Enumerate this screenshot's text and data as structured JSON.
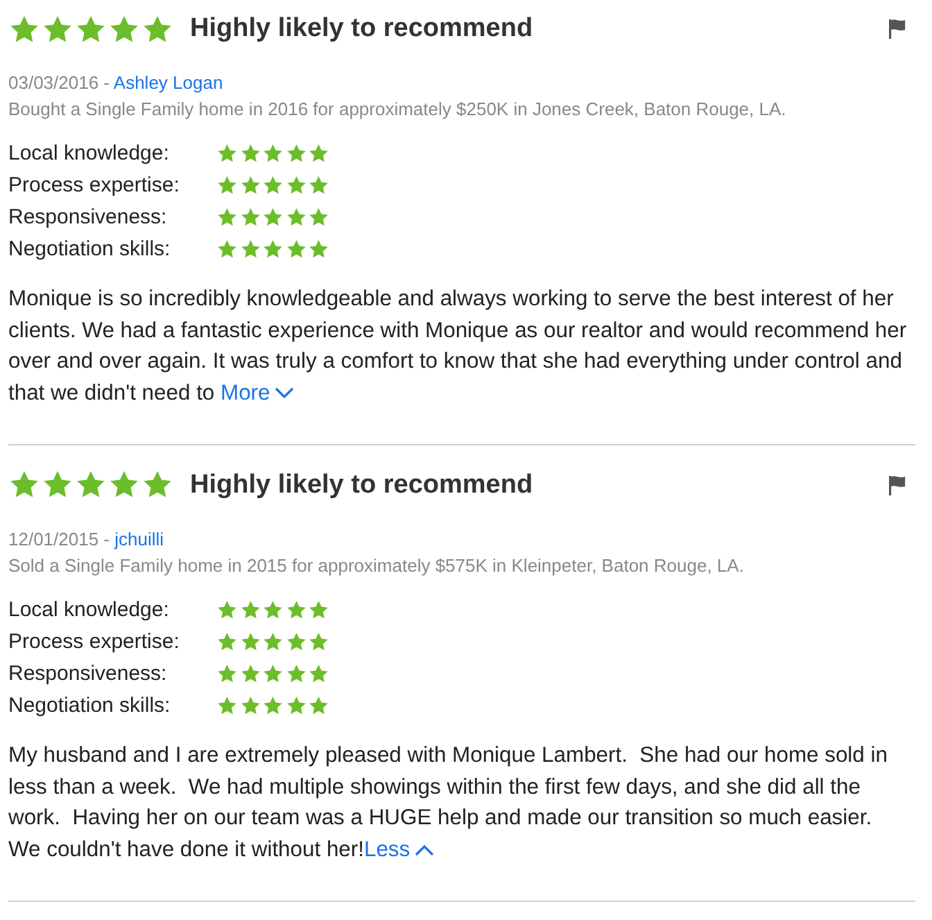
{
  "reviews": [
    {
      "stars": 5,
      "headline": "Highly likely to recommend",
      "date": "03/03/2016 - ",
      "author": "Ashley Logan",
      "summary": "Bought a Single Family home in 2016 for approximately $250K in Jones Creek, Baton Rouge, LA.",
      "ratings": [
        {
          "label": "Local knowledge:",
          "stars": 5
        },
        {
          "label": "Process expertise:",
          "stars": 5
        },
        {
          "label": "Responsiveness:",
          "stars": 5
        },
        {
          "label": "Negotiation skills:",
          "stars": 5
        }
      ],
      "text": "Monique is so incredibly knowledgeable and always working to serve the best interest of her clients. We had a fantastic experience with Monique as our realtor and would recommend her over and over again. It was truly a comfort to know that she had everything under control and that we didn't need to ",
      "toggle": {
        "label": "More",
        "expanded": false
      }
    },
    {
      "stars": 5,
      "headline": "Highly likely to recommend",
      "date": "12/01/2015 - ",
      "author": "jchuilli",
      "summary": "Sold a Single Family home in 2015 for approximately $575K in Kleinpeter, Baton Rouge, LA.",
      "ratings": [
        {
          "label": "Local knowledge:",
          "stars": 5
        },
        {
          "label": "Process expertise:",
          "stars": 5
        },
        {
          "label": "Responsiveness:",
          "stars": 5
        },
        {
          "label": "Negotiation skills:",
          "stars": 5
        }
      ],
      "text": "My husband and I are extremely pleased with Monique Lambert.  She had our home sold in less than a week.  We had multiple showings within the first few days, and she did all the work.  Having her on our team was a HUGE help and made our transition so much easier.  We couldn't have done it without her!",
      "toggle": {
        "label": "Less",
        "expanded": true
      }
    }
  ]
}
